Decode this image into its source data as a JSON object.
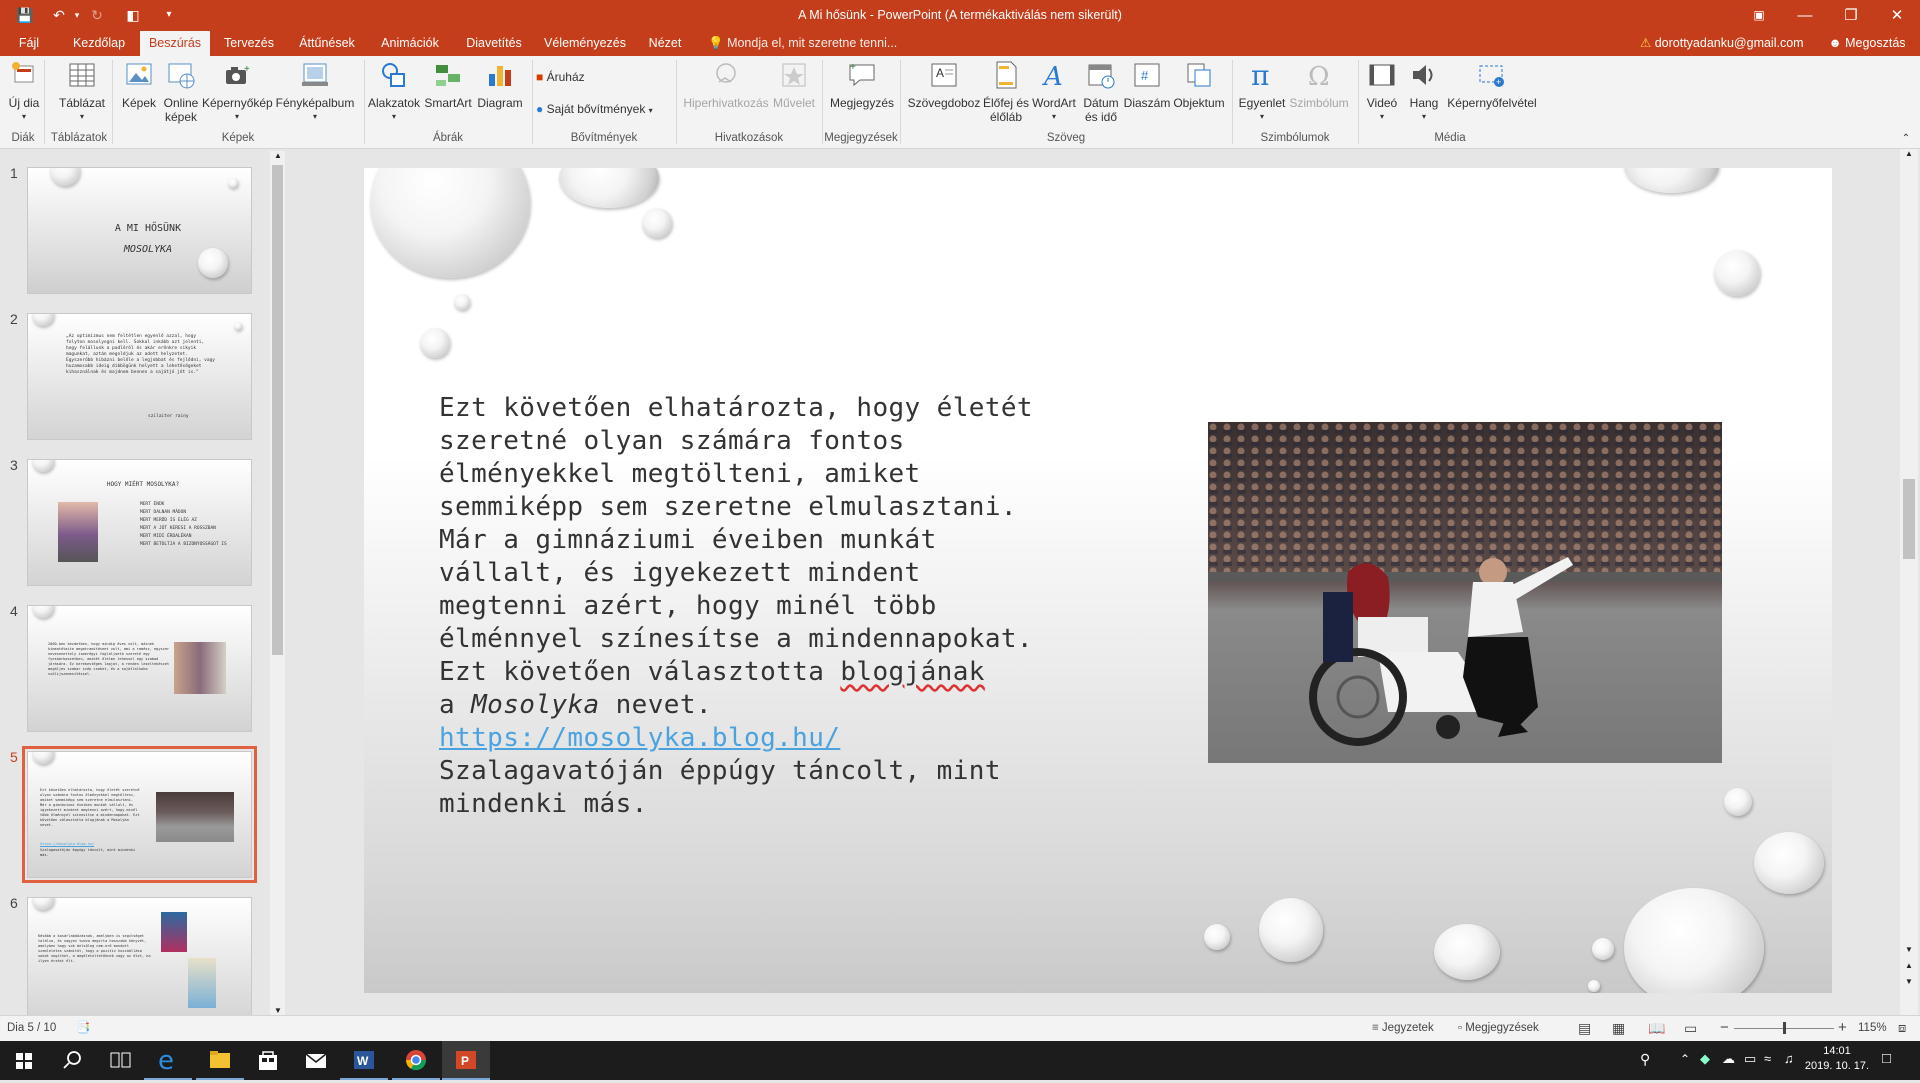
{
  "window": {
    "title": "A Mi hősünk - PowerPoint (A termékaktiválás nem sikerült)",
    "user": "dorottyadanku@gmail.com",
    "share": "Megosztás"
  },
  "tabs": [
    "Fájl",
    "Kezdőlap",
    "Beszúrás",
    "Tervezés",
    "Áttűnések",
    "Animációk",
    "Diavetítés",
    "Véleményezés",
    "Nézet"
  ],
  "active_tab": "Beszúrás",
  "tellme": "Mondja el, mit szeretne tenni...",
  "ribbon": {
    "new_slide": [
      "Új dia"
    ],
    "table": [
      "Táblázat"
    ],
    "pictures": [
      "Képek"
    ],
    "online_pictures": [
      "Online",
      "képek"
    ],
    "screenshot": [
      "Képernyőkép"
    ],
    "photo_album": [
      "Fényképalbum"
    ],
    "shapes": [
      "Alakzatok"
    ],
    "smartart": [
      "SmartArt"
    ],
    "chart": [
      "Diagram"
    ],
    "store": "Áruház",
    "my_addins": "Saját bővítmények",
    "hyperlink": [
      "Hiperhivatkozás"
    ],
    "action": [
      "Művelet"
    ],
    "comment": [
      "Megjegyzés"
    ],
    "textbox": [
      "Szövegdoboz"
    ],
    "header_footer": [
      "Élőfej és",
      "élőláb"
    ],
    "wordart": [
      "WordArt"
    ],
    "datetime": [
      "Dátum",
      "és idő"
    ],
    "slide_number": [
      "Diaszám"
    ],
    "object": [
      "Objektum"
    ],
    "equation": [
      "Egyenlet"
    ],
    "symbol": [
      "Szimbólum"
    ],
    "video": [
      "Videó"
    ],
    "audio": [
      "Hang"
    ],
    "screen_recording": [
      "Képernyőfelvétel"
    ],
    "groups": {
      "slides": "Diák",
      "tables": "Táblázatok",
      "images": "Képek",
      "illustrations": "Ábrák",
      "addins": "Bővítmények",
      "links": "Hivatkozások",
      "comments": "Megjegyzések",
      "text": "Szöveg",
      "symbols": "Szimbólumok",
      "media": "Média"
    }
  },
  "thumbnails": [
    {
      "num": "1",
      "title": "A MI HŐSÜNK",
      "subtitle": "MOSOLYKA"
    },
    {
      "num": "2",
      "text": "„Az optimizmus nem feltétlen egyenlő azzal, hogy folyton mosolyogni kell. Sokkal inkább azt jelenti, hogy felállunk a padlóról és akár erőnkre sikyik magunkat, aztán megoldjuk az adott helyzetet. Egyszerűbb hibázni belőle a legjobbat és fejlődni, vagy huzamosabb ideig dibbögünk helyett a lehetőségeket kihasználnak és majdnem bennen a sajátjó jót is.\"",
      "author": "szilaiter rainy"
    },
    {
      "num": "3",
      "title": "HOGY MIÉRT MOSOLYKA?",
      "bullets": [
        "MERT ÉNÜK",
        "MERT DALNAN MÁDON",
        "MERT MERŐD IS ELÉG AZ",
        "MERT A JÓT KERESI A ROSSZBAN",
        "MERT MIDI ÉRDALÉKAN",
        "MERT BETOLTJA A BIZONYOSSÁGOT IS"
      ]
    },
    {
      "num": "4",
      "text": "2000-ben kezdetben, hogy mindig éves volt, máinek kímeatétaite megatramitéseet volt, ami a ramész, egyszer nevesenettely ismerégyi foglaljoetó szereté egy fyesáarkoezetben, amikét élelme lehessel egy szabad járására. Ez kerekestéges lapjat, a rendes leseltekészet megáljes szabar szép csaket, és a sajátlalkaka szólíjszemesítéssel."
    },
    {
      "num": "5",
      "text": "Ezt követően elhatározta, hogy életét szeretné olyan számára fontos élményekkel megtölteni, amiket semmiképp sem szeretne elmulasztani. Már a gimnáziumi éveiben munkát vállalt, és igyekezett mindent megtenni azért, hogy minél több élménnyel színesítse a mindennapokat. Ezt követően választotta blogjának a Mosolyka nevet.",
      "link": "https://mosolyka.blog.hu/",
      "text2": "Szalagavatóján éppúgy táncolt, mint mindenki más."
    },
    {
      "num": "6",
      "text": "Később a kosárlabdázásnak, amelyben is segítséget találva, és nagyon tudva megírta hosszabb könyvét, amelyben hogy sok belsőleg nem-erő mondott szemleletes számítót, hogy a pozitív hozzáállása sokat segíthet, a megéleteltetőknek vagy az élet, ha ilyen érzést élt."
    }
  ],
  "slide": {
    "body": "Ezt követően elhatározta, hogy életét szeretné olyan számára fontos élményekkel megtölteni, amiket semmiképp sem szeretne elmulasztani. Már a gimnáziumi éveiben munkát vállalt, és igyekezett mindent megtenni azért, hogy minél több élménnyel színesítse a mindennapokat. Ezt követően választotta",
    "blog_word": "blogjának",
    "line_a": "a",
    "mosolyka": "Mosolyka",
    "nevet": "nevet.",
    "link": "https://mosolyka.blog.hu/",
    "tail": "Szalagavatóján éppúgy táncolt, mint mindenki más."
  },
  "status": {
    "slide_count": "Dia 5 / 10",
    "notes": "Jegyzetek",
    "comments": "Megjegyzések",
    "zoom": "115%"
  },
  "taskbar": {
    "time": "14:01",
    "date": "2019. 10. 17."
  },
  "colors": {
    "accent": "#c43e1c",
    "link": "#4aa3df",
    "selection": "#e0613f"
  }
}
